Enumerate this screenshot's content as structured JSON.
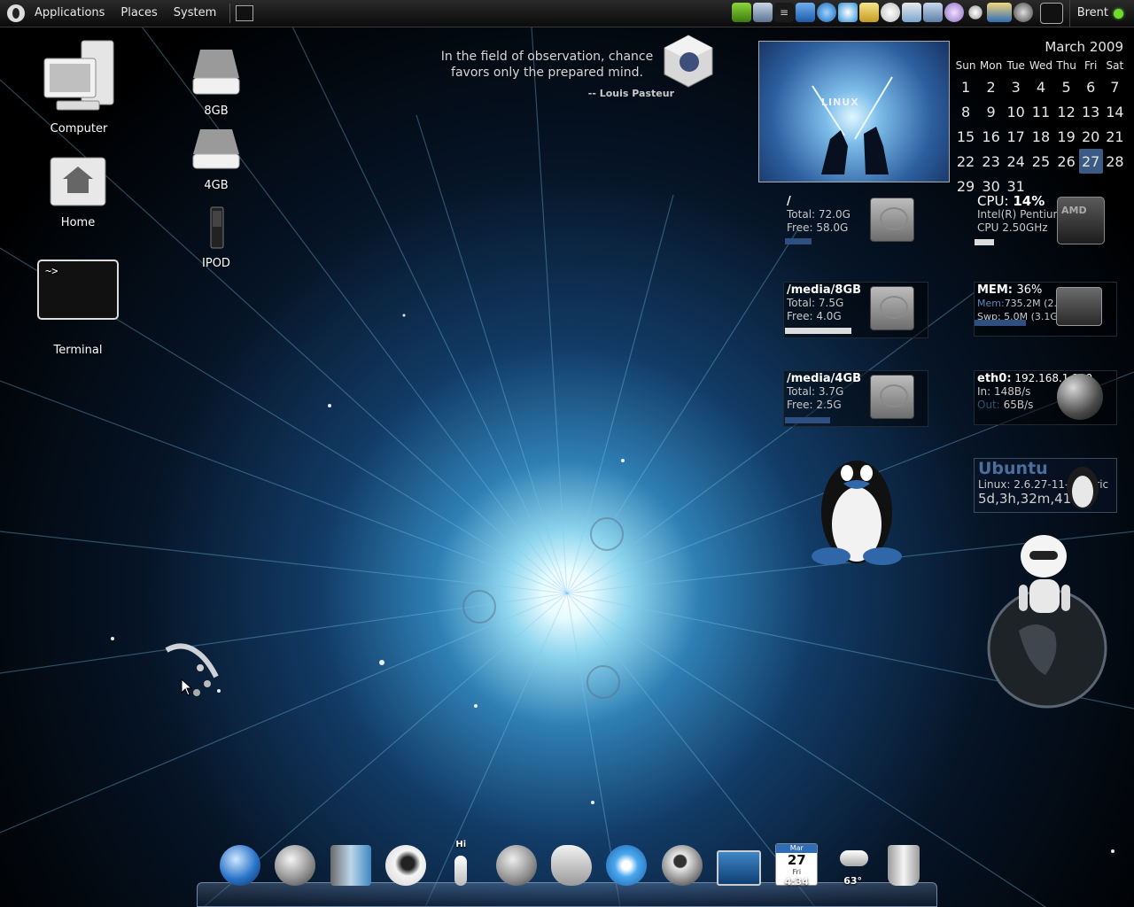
{
  "panel": {
    "menus": [
      "Applications",
      "Places",
      "System"
    ],
    "user": "Brent",
    "tray_icons": [
      "nvidia-icon",
      "network-icon",
      "list-icon",
      "word-icon",
      "compass-icon",
      "atom-icon",
      "folder-icon",
      "clock-icon",
      "weather-icon",
      "puzzle-icon",
      "gear-icon",
      "toggle-icon",
      "screen-icon",
      "settings-icon",
      "window-icon"
    ],
    "status_color": "#6ddc2d"
  },
  "desktop": {
    "icons": [
      {
        "label": "Computer"
      },
      {
        "label": "Home"
      },
      {
        "label": "Terminal"
      },
      {
        "label": "8GB"
      },
      {
        "label": "4GB"
      },
      {
        "label": "IPOD"
      }
    ]
  },
  "quote": {
    "line1": "In the field of observation, chance",
    "line2": "favors only the prepared mind.",
    "author": "-- Louis Pasteur"
  },
  "photo": {
    "text": "LINUX"
  },
  "calendar": {
    "title": "March 2009",
    "days": [
      "Sun",
      "Mon",
      "Tue",
      "Wed",
      "Thu",
      "Fri",
      "Sat"
    ],
    "weeks": [
      [
        "1",
        "2",
        "3",
        "4",
        "5",
        "6",
        "7"
      ],
      [
        "8",
        "9",
        "10",
        "11",
        "12",
        "13",
        "14"
      ],
      [
        "15",
        "16",
        "17",
        "18",
        "19",
        "20",
        "21"
      ],
      [
        "22",
        "23",
        "24",
        "25",
        "26",
        "27",
        "28"
      ],
      [
        "29",
        "30",
        "31",
        "",
        "",
        "",
        ""
      ]
    ],
    "today": "27"
  },
  "disks": [
    {
      "mount": "/",
      "total": "Total: 72.0G",
      "free": "Free: 58.0G",
      "used_fraction": 0.19
    },
    {
      "mount": "/media/8GB",
      "total": "Total: 7.5G",
      "free": "Free: 4.0G",
      "used_fraction": 0.47
    },
    {
      "mount": "/media/4GB",
      "total": "Total: 3.7G",
      "free": "Free: 2.5G",
      "used_fraction": 0.32
    }
  ],
  "cpu": {
    "label": "CPU:",
    "percent": "14%",
    "model": "Intel(R) Pentium(R) 4",
    "speed": "CPU 2.50GHz",
    "load": 0.14,
    "chip": "AMD"
  },
  "mem": {
    "label": "MEM:",
    "percent": "36%",
    "mem_label": "Mem:",
    "mem_value": "735.2M (2.0G)",
    "swp": "Swp: 5.0M (3.1G)",
    "load": 0.36
  },
  "net": {
    "label": "eth0:",
    "ip": "192.168.1.100",
    "in": "In:   148B/s",
    "out_label": "Out:",
    "out_value": "65B/s"
  },
  "ubuntu": {
    "name": "Ubuntu",
    "kernel": "Linux: 2.6.27-11-generic",
    "uptime": "5d,3h,32m,41s"
  },
  "dock": {
    "items": [
      "firefox-icon",
      "mail-icon",
      "notes-icon",
      "wolf-icon",
      "pidgin-icon",
      "deathstar-icon",
      "gimp-icon",
      "atom-app-icon",
      "search-icon",
      "system-monitor-icon",
      "calendar-icon",
      "weather-icon",
      "trash-icon"
    ],
    "pidgin_text": "Hi",
    "calendar_month": "Mar",
    "calendar_day": "27",
    "calendar_weekday": "Fri",
    "clock": "4:34",
    "temperature": "63°"
  }
}
